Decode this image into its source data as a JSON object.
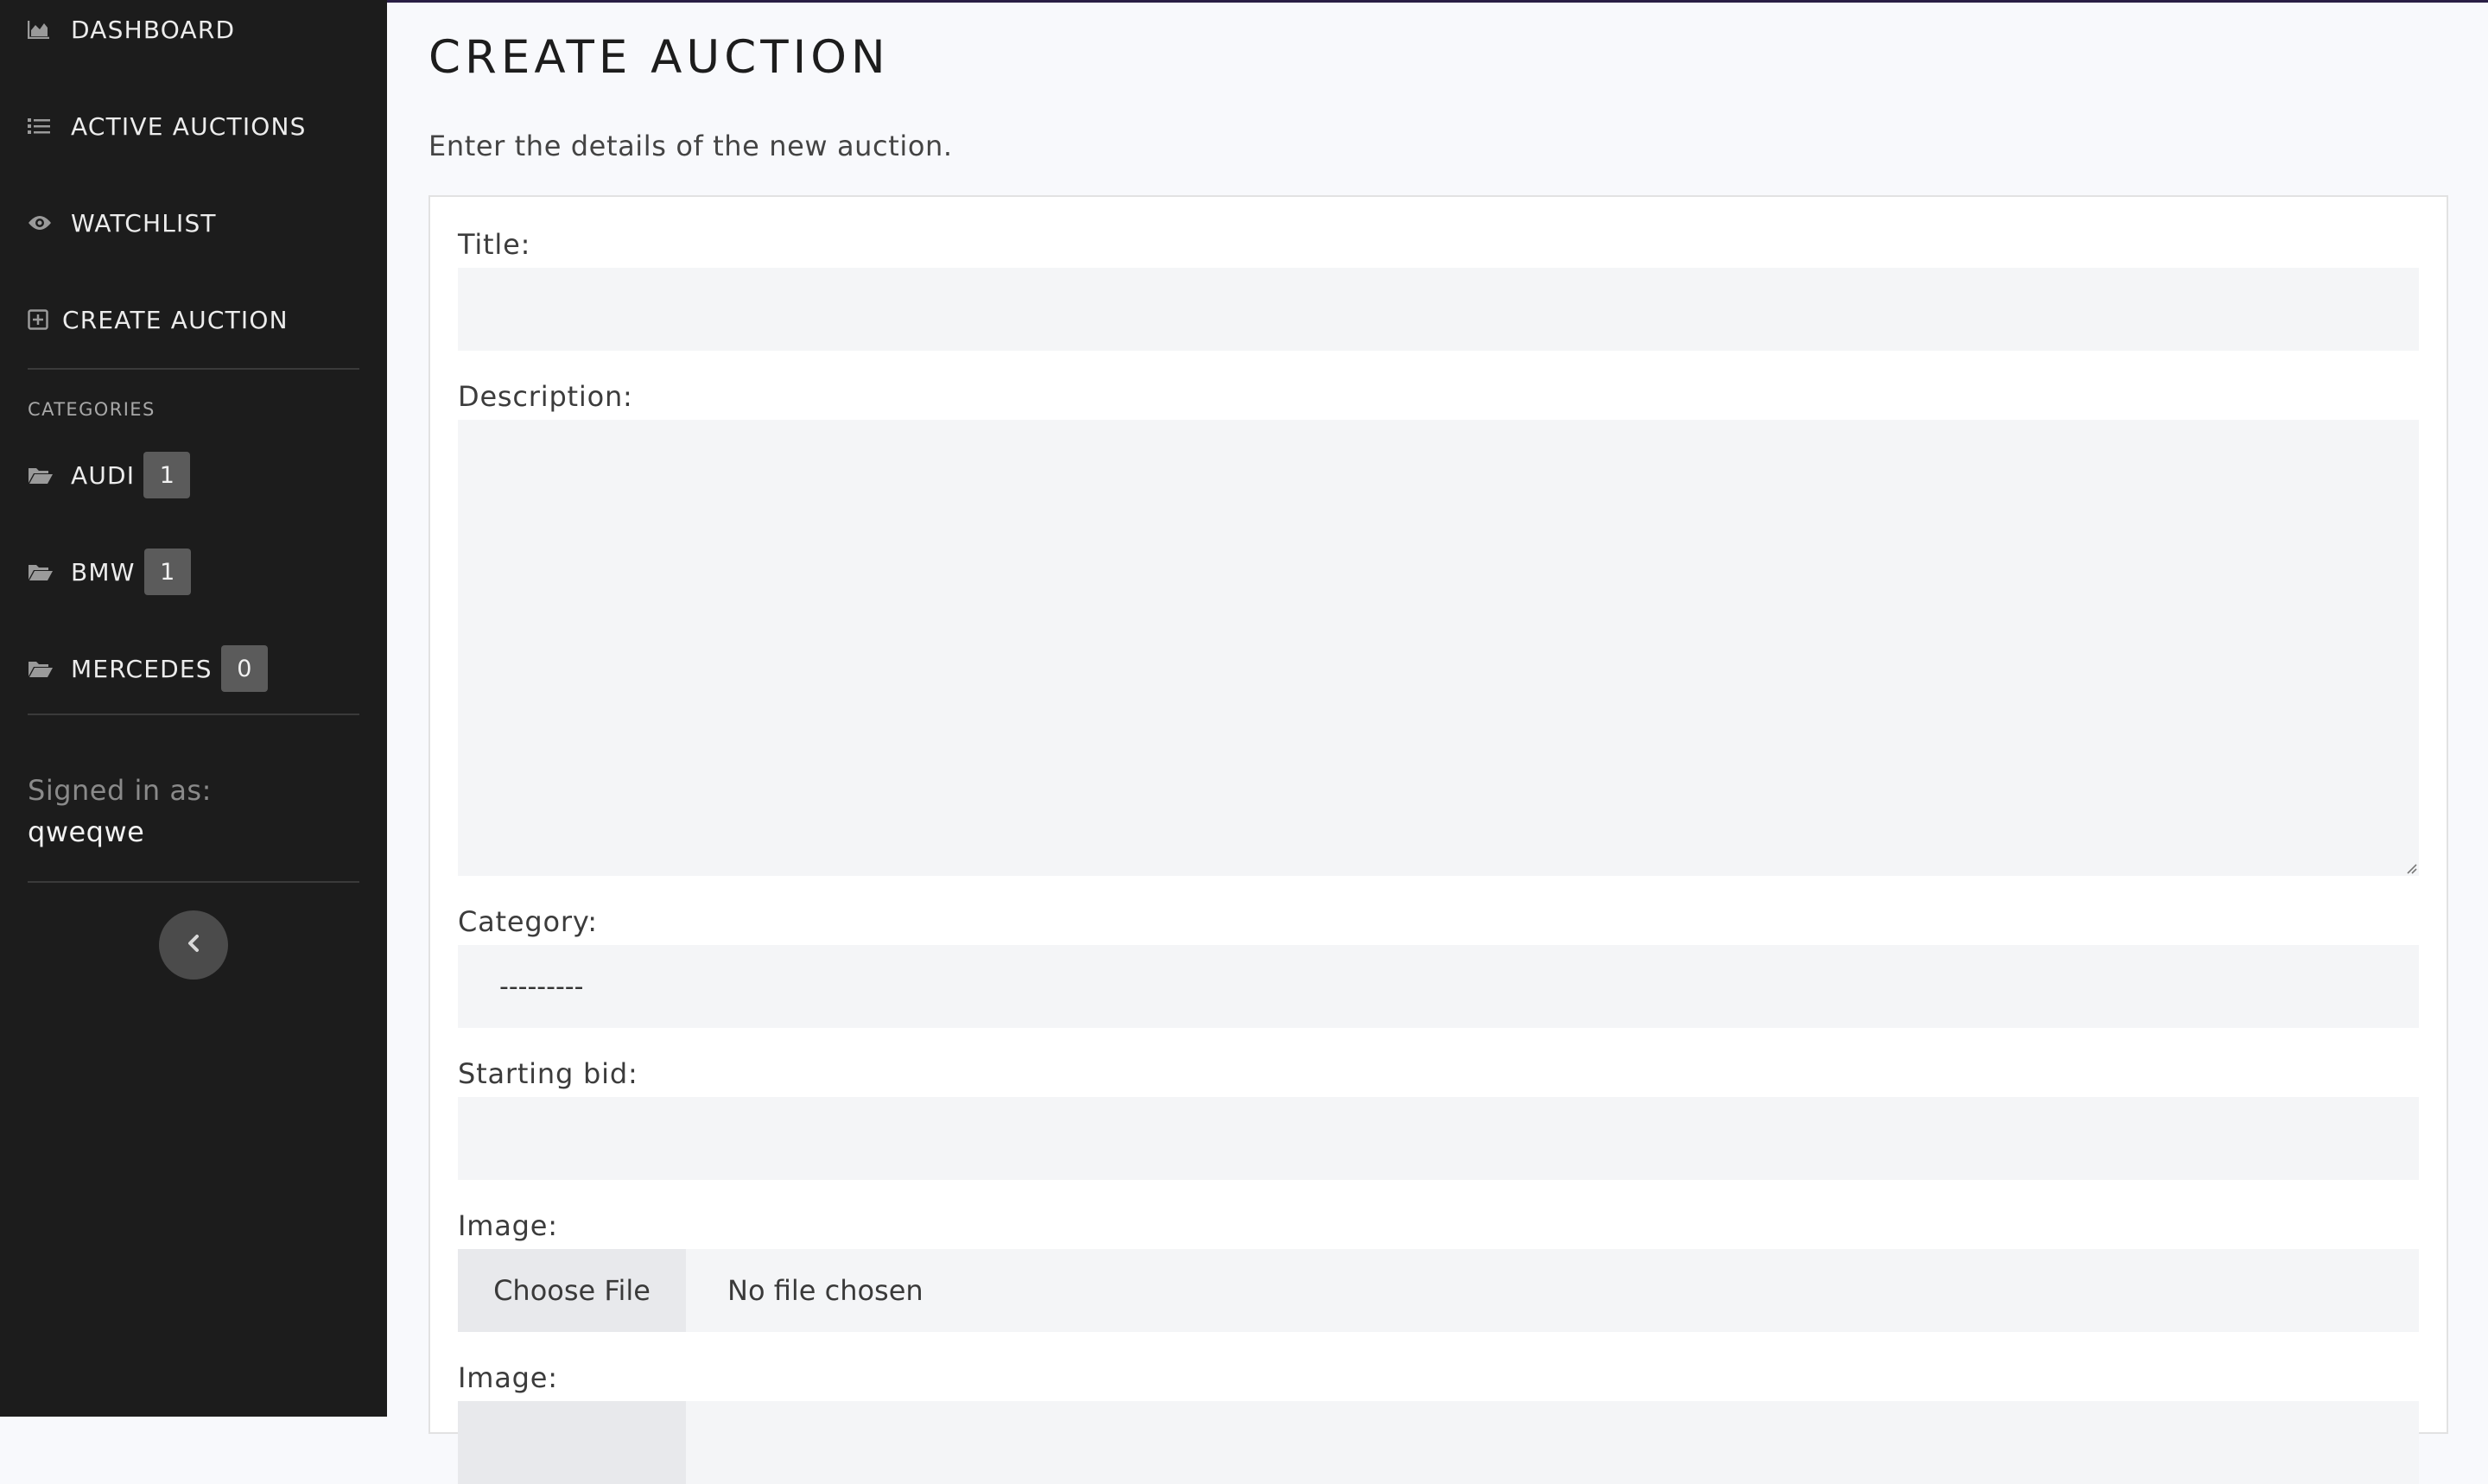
{
  "sidebar": {
    "nav": [
      {
        "label": "DASHBOARD",
        "icon": "area-chart-icon"
      },
      {
        "label": "ACTIVE AUCTIONS",
        "icon": "list-icon"
      },
      {
        "label": "WATCHLIST",
        "icon": "eye-icon"
      },
      {
        "label": "CREATE AUCTION",
        "icon": "plus-square-icon"
      }
    ],
    "categories_heading": "CATEGORIES",
    "categories": [
      {
        "label": "AUDI",
        "count": "1",
        "icon": "folder-open-icon"
      },
      {
        "label": "BMW",
        "count": "1",
        "icon": "folder-open-icon"
      },
      {
        "label": "MERCEDES",
        "count": "0",
        "icon": "folder-open-icon"
      }
    ],
    "signed_in_label": "Signed in as:",
    "username": "qweqwe",
    "collapse_icon": "chevron-left-icon"
  },
  "main": {
    "title": "CREATE AUCTION",
    "subtitle": "Enter the details of the new auction.",
    "form": {
      "title_label": "Title:",
      "title_value": "",
      "description_label": "Description:",
      "description_value": "",
      "category_label": "Category:",
      "category_selected": "---------",
      "starting_bid_label": "Starting bid:",
      "starting_bid_value": "",
      "image1_label": "Image:",
      "image1_button": "Choose File",
      "image1_status": "No file chosen",
      "image2_label": "Image:"
    }
  },
  "colors": {
    "sidebar_bg": "#1c1c1c",
    "main_bg": "#f8f9fc",
    "field_bg": "#f4f5f7",
    "badge_bg": "#5b5b5b",
    "top_accent": "#2a1f45"
  }
}
